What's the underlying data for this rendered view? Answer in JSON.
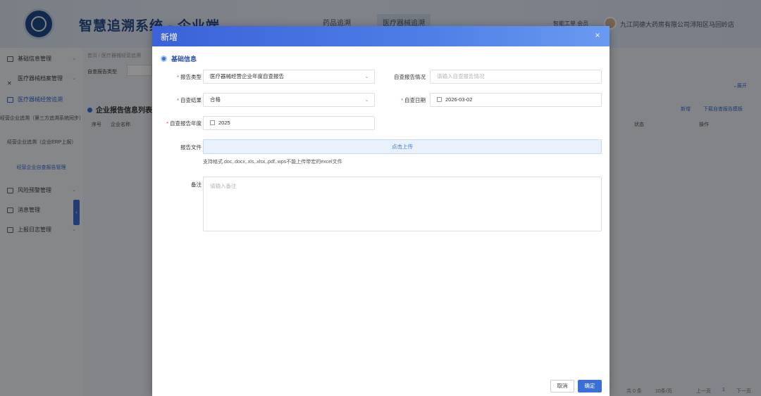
{
  "app": {
    "title": "智慧追溯系统 - 企业端",
    "top_tabs": [
      "药品追溯",
      "医疗器械追溯"
    ],
    "top_right_text": "智能工单 会员",
    "user_name": "九江同德大药房有限公司浔阳区马回岭店"
  },
  "sidebar": {
    "items": [
      "基础信息管理",
      "医疗器械档案管理",
      "医疗器械经营追溯",
      "风险预警管理",
      "消息管理",
      "上报日志管理"
    ],
    "sub_items": [
      "经营企业追溯（第三方追溯系统同步）",
      "经营企业追溯（企业ERP上报）",
      "经营企业自查报告管理"
    ]
  },
  "page": {
    "breadcrumb": "首页 / 医疗器械经营追溯",
    "filter_label": "自查报告类型",
    "filter_placeholder": "请选择",
    "expand": "展开",
    "list_title": "企业报告信息列表",
    "add_link": "新增",
    "download_link": "下载自查报告模板",
    "columns": [
      "序号",
      "企业名称",
      "状态",
      "操作"
    ],
    "pager_total": "共 0 条",
    "pager_size": "10条/页",
    "pager_prev": "上一页",
    "pager_page": "1",
    "pager_next": "下一页"
  },
  "modal": {
    "title": "新增",
    "close": "×",
    "section_title": "基础信息",
    "fields": {
      "report_type": {
        "label": "报告类型",
        "value": "医疗器械经营企业年度自查报告"
      },
      "report_status": {
        "label": "自查报告情况",
        "placeholder": "请输入自查报告情况"
      },
      "result": {
        "label": "自查结果",
        "value": "合格"
      },
      "date": {
        "label": "自查日期",
        "value": "2026-03-02"
      },
      "year": {
        "label": "自查报告年度",
        "value": "2025"
      },
      "file": {
        "label": "报告文件",
        "upload_text": "点击上传",
        "hint": "支持格式.doc,.docx,.xls,.xlsx,.pdf,.wps不能上传带宏的excel文件"
      },
      "remark": {
        "label": "备注",
        "placeholder": "请输入备注"
      }
    },
    "cancel": "取消",
    "confirm": "确定"
  },
  "colors": {
    "primary": "#3a6fd8",
    "required": "#e0453a",
    "header_start": "#3b62d9",
    "header_end": "#6a9af0"
  }
}
